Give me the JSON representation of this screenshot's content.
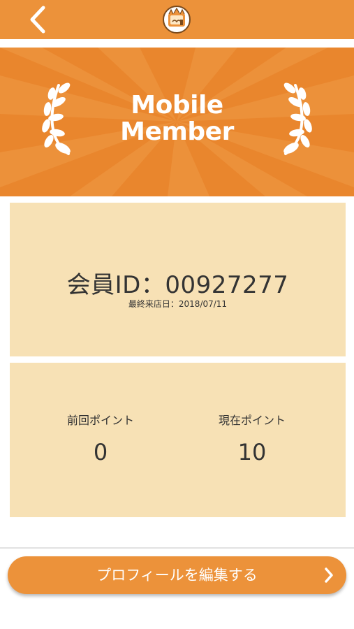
{
  "header": {
    "back_icon": "chevron-left-icon",
    "logo_icon": "store-logo-icon"
  },
  "banner": {
    "title_line1": "Mobile",
    "title_line2": "Member",
    "decor_icon": "laurel-icon"
  },
  "member": {
    "id_text": "会員ID：00927277",
    "last_visit_text": "最終来店日：2018/07/11"
  },
  "points": {
    "previous_label": "前回ポイント",
    "previous_value": "0",
    "current_label": "現在ポイント",
    "current_value": "10"
  },
  "actions": {
    "edit_profile_label": "プロフィールを編集する",
    "edit_profile_icon": "chevron-right-icon"
  },
  "colors": {
    "accent": "#ec923a",
    "banner": "#e9862d",
    "card": "#f7e1b5",
    "text": "#333333"
  }
}
